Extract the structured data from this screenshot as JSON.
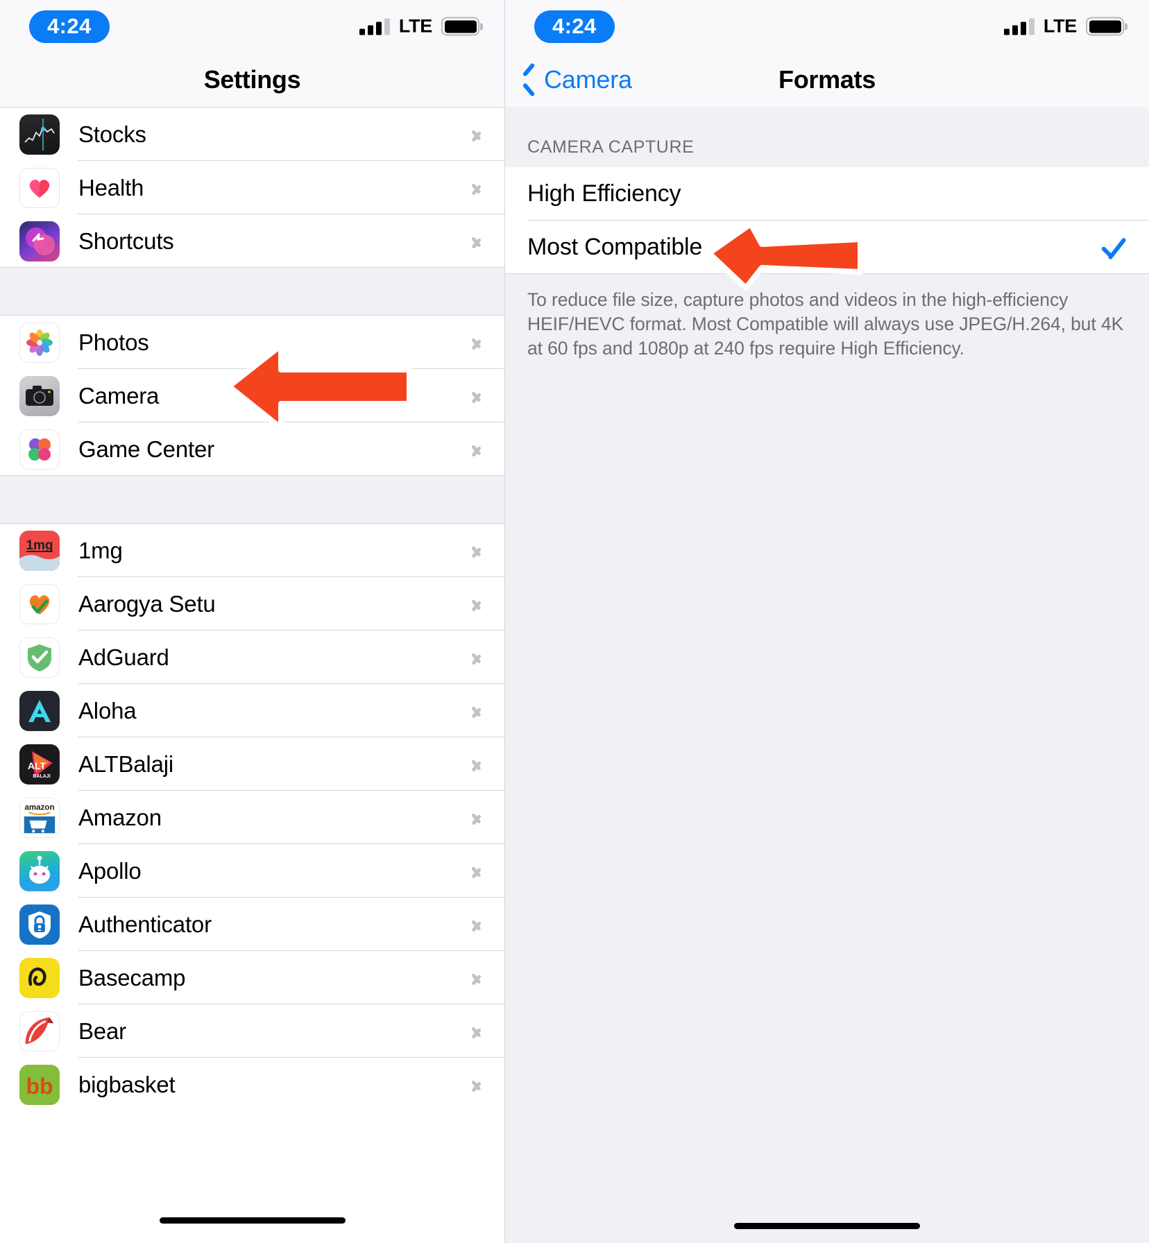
{
  "status": {
    "time": "4:24",
    "carrier": "LTE",
    "signal_bars_filled": 3,
    "signal_bars_total": 4,
    "battery_full": true
  },
  "left_panel": {
    "title": "Settings",
    "groups": [
      {
        "items": [
          {
            "label": "Stocks",
            "icon": "stocks-app-icon",
            "icon_class": "ic-stocks",
            "glyph": ""
          },
          {
            "label": "Health",
            "icon": "health-app-icon",
            "icon_class": "ic-health",
            "glyph": "♥"
          },
          {
            "label": "Shortcuts",
            "icon": "shortcuts-app-icon",
            "icon_class": "ic-shortcuts",
            "glyph": ""
          }
        ]
      },
      {
        "items": [
          {
            "label": "Photos",
            "icon": "photos-app-icon",
            "icon_class": "ic-photos",
            "glyph": ""
          },
          {
            "label": "Camera",
            "icon": "camera-app-icon",
            "icon_class": "ic-camera",
            "glyph": ""
          },
          {
            "label": "Game Center",
            "icon": "game-center-app-icon",
            "icon_class": "ic-gamecenter",
            "glyph": ""
          }
        ]
      },
      {
        "items": [
          {
            "label": "1mg",
            "icon": "onemg-app-icon",
            "icon_class": "ic-1mg",
            "glyph": "1mg"
          },
          {
            "label": "Aarogya Setu",
            "icon": "aarogya-setu-app-icon",
            "icon_class": "ic-aarogya",
            "glyph": ""
          },
          {
            "label": "AdGuard",
            "icon": "adguard-app-icon",
            "icon_class": "ic-adguard",
            "glyph": ""
          },
          {
            "label": "Aloha",
            "icon": "aloha-app-icon",
            "icon_class": "ic-aloha",
            "glyph": "A"
          },
          {
            "label": "ALTBalaji",
            "icon": "altbalaji-app-icon",
            "icon_class": "ic-alt",
            "glyph": ""
          },
          {
            "label": "Amazon",
            "icon": "amazon-app-icon",
            "icon_class": "ic-amazon",
            "glyph": ""
          },
          {
            "label": "Apollo",
            "icon": "apollo-app-icon",
            "icon_class": "ic-apollo",
            "glyph": ""
          },
          {
            "label": "Authenticator",
            "icon": "authenticator-app-icon",
            "icon_class": "ic-auth",
            "glyph": ""
          },
          {
            "label": "Basecamp",
            "icon": "basecamp-app-icon",
            "icon_class": "ic-basecamp",
            "glyph": ""
          },
          {
            "label": "Bear",
            "icon": "bear-app-icon",
            "icon_class": "ic-bear",
            "glyph": ""
          },
          {
            "label": "bigbasket",
            "icon": "bigbasket-app-icon",
            "icon_class": "ic-bigbasket",
            "glyph": "bb"
          }
        ]
      }
    ]
  },
  "right_panel": {
    "back_label": "Camera",
    "title": "Formats",
    "section_header": "CAMERA CAPTURE",
    "options": [
      {
        "label": "High Efficiency",
        "selected": false
      },
      {
        "label": "Most Compatible",
        "selected": true
      }
    ],
    "footer_note": "To reduce file size, capture photos and videos in the high-efficiency HEIF/HEVC format. Most Compatible will always use JPEG/H.264, but 4K at 60 fps and 1080p at 240 fps require High Efficiency."
  },
  "annotations": {
    "arrow_color": "#f4441e",
    "arrow_outline": "#ffffff",
    "arrows": [
      {
        "name": "arrow-pointing-to-camera-row"
      },
      {
        "name": "arrow-pointing-to-most-compatible-row"
      }
    ]
  }
}
